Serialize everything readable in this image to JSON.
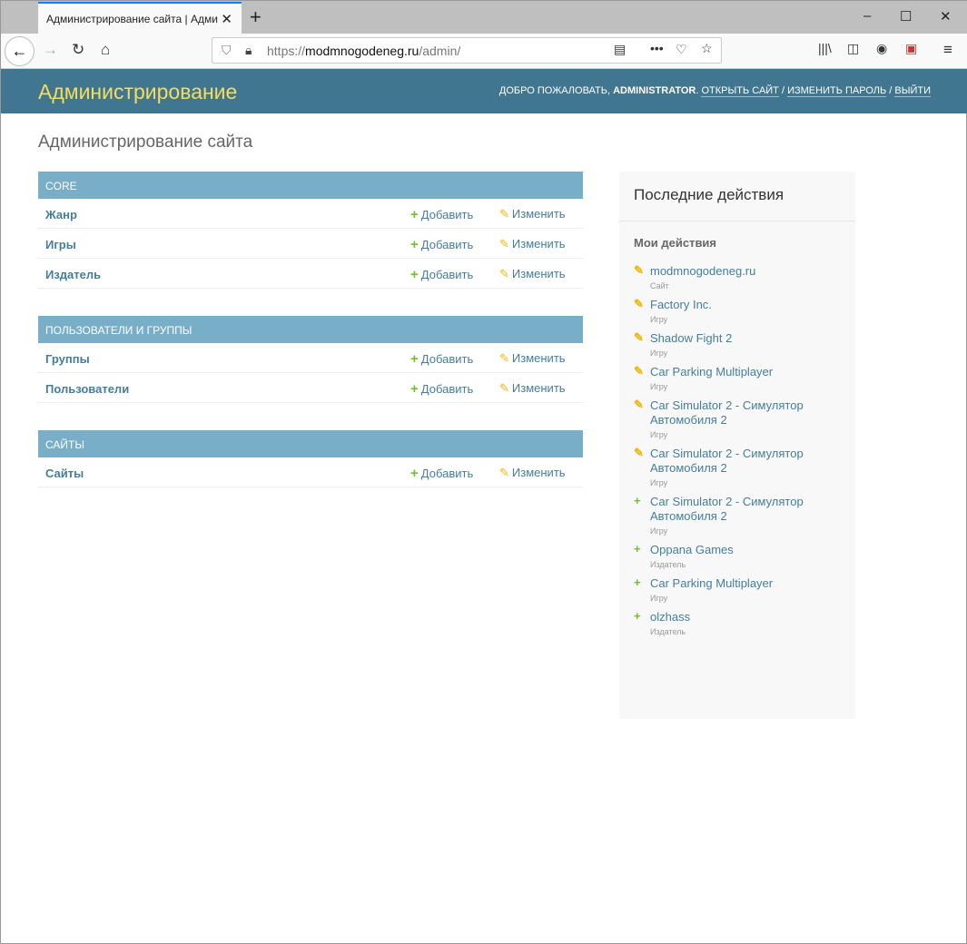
{
  "browser": {
    "tab_title": "Администрирование сайта | Адми",
    "url_prefix": "https://",
    "url_host": "modmnogodeneg.ru",
    "url_path": "/admin/"
  },
  "header": {
    "brand": "Администрирование",
    "welcome": "Добро пожаловать,",
    "user": "ADMINISTRATOR",
    "view_site": "Открыть сайт",
    "change_password": "Изменить пароль",
    "logout": "Выйти",
    "sep": "/"
  },
  "page_title": "Администрирование сайта",
  "add_label": "Добавить",
  "change_label": "Изменить",
  "modules": [
    {
      "caption": "Core",
      "models": [
        "Жанр",
        "Игры",
        "Издатель"
      ]
    },
    {
      "caption": "Пользователи и группы",
      "models": [
        "Группы",
        "Пользователи"
      ]
    },
    {
      "caption": "Сайты",
      "models": [
        "Сайты"
      ]
    }
  ],
  "recent": {
    "title": "Последние действия",
    "subtitle": "Мои действия",
    "items": [
      {
        "name": "modmnogodeneg.ru",
        "type": "Сайт",
        "action": "change"
      },
      {
        "name": "Factory Inc.",
        "type": "Игру",
        "action": "change"
      },
      {
        "name": "Shadow Fight 2",
        "type": "Игру",
        "action": "change"
      },
      {
        "name": "Car Parking Multiplayer",
        "type": "Игру",
        "action": "change"
      },
      {
        "name": "Car Simulator 2 - Симулятор Автомобиля 2",
        "type": "Игру",
        "action": "change"
      },
      {
        "name": "Car Simulator 2 - Симулятор Автомобиля 2",
        "type": "Игру",
        "action": "change"
      },
      {
        "name": "Car Simulator 2 - Симулятор Автомобиля 2",
        "type": "Игру",
        "action": "add"
      },
      {
        "name": "Oppana Games",
        "type": "Издатель",
        "action": "add"
      },
      {
        "name": "Car Parking Multiplayer",
        "type": "Игру",
        "action": "add"
      },
      {
        "name": "olzhass",
        "type": "Издатель",
        "action": "add"
      }
    ]
  }
}
